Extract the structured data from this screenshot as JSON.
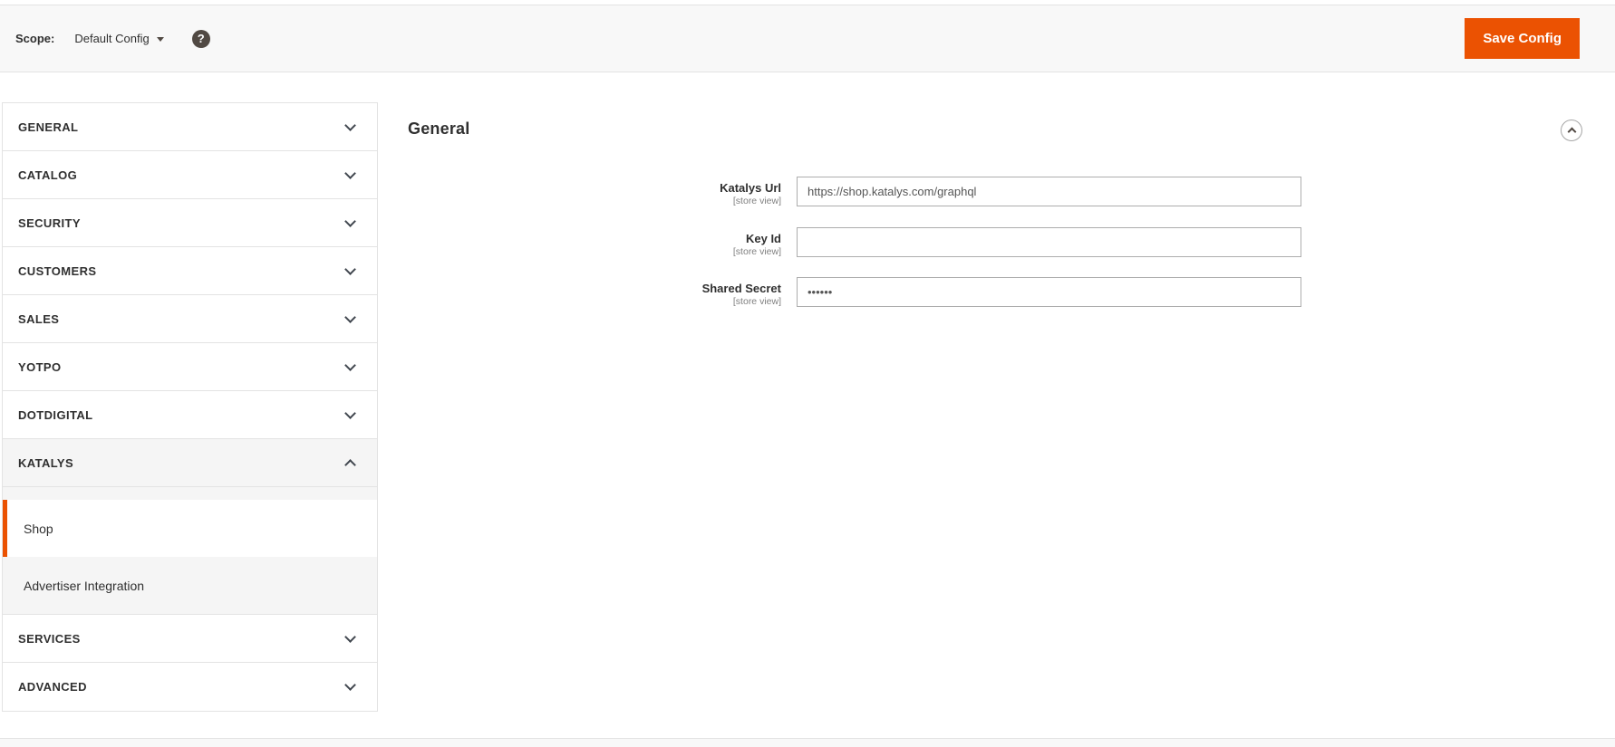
{
  "scope_bar": {
    "scope_label": "Scope:",
    "scope_value": "Default Config",
    "help_glyph": "?",
    "save_button_label": "Save Config"
  },
  "sidebar": {
    "sections": [
      {
        "label": "GENERAL",
        "state": "collapsed"
      },
      {
        "label": "CATALOG",
        "state": "collapsed"
      },
      {
        "label": "SECURITY",
        "state": "collapsed"
      },
      {
        "label": "CUSTOMERS",
        "state": "collapsed"
      },
      {
        "label": "SALES",
        "state": "collapsed"
      },
      {
        "label": "YOTPO",
        "state": "collapsed"
      },
      {
        "label": "DOTDIGITAL",
        "state": "collapsed"
      },
      {
        "label": "KATALYS",
        "state": "expanded",
        "children": [
          {
            "label": "Shop",
            "active": true
          },
          {
            "label": "Advertiser Integration",
            "active": false
          }
        ]
      },
      {
        "label": "SERVICES",
        "state": "collapsed"
      },
      {
        "label": "ADVANCED",
        "state": "collapsed"
      }
    ]
  },
  "main": {
    "section_title": "General",
    "fields": [
      {
        "label": "Katalys Url",
        "scope_note": "[store view]",
        "value": "https://shop.katalys.com/graphql"
      },
      {
        "label": "Key Id",
        "scope_note": "[store view]",
        "value": ""
      },
      {
        "label": "Shared Secret",
        "scope_note": "[store view]",
        "value": "••••••"
      }
    ]
  },
  "colors": {
    "accent": "#eb5202",
    "bar_bg": "#f8f8f8",
    "border": "#e3e3e3",
    "expanded_bg": "#f5f5f5",
    "text": "#303030",
    "muted": "#808080"
  }
}
